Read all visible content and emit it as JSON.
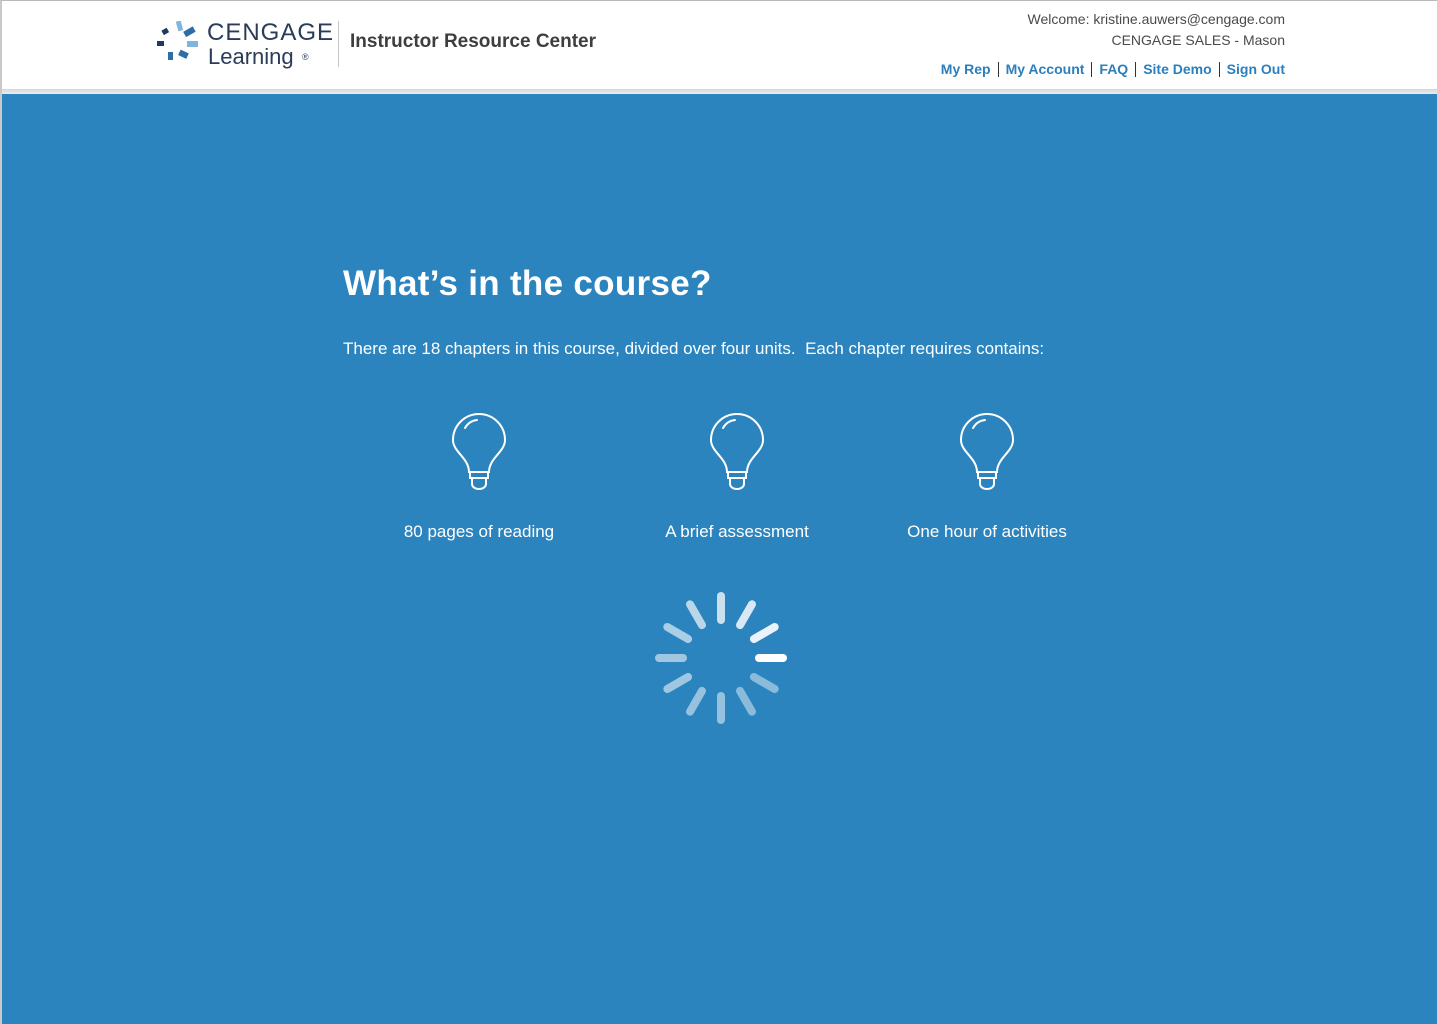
{
  "header": {
    "logo_top": "CENGAGE",
    "logo_bottom": "Learning",
    "logo_reg": "®",
    "site_title": "Instructor Resource Center",
    "welcome": "Welcome: kristine.auwers@cengage.com",
    "account_name": "CENGAGE SALES - Mason",
    "nav": {
      "my_rep": "My Rep",
      "my_account": "My Account",
      "faq": "FAQ",
      "site_demo": "Site Demo",
      "sign_out": "Sign Out"
    }
  },
  "main": {
    "heading": "What’s in the course?",
    "intro": "There are 18 chapters in this course, divided over four units.  Each chapter requires contains:",
    "features": [
      {
        "icon": "lightbulb-icon",
        "label": "80 pages of reading"
      },
      {
        "icon": "lightbulb-icon",
        "label": "A brief assessment"
      },
      {
        "icon": "lightbulb-icon",
        "label": "One hour of activities"
      }
    ],
    "loading_icon": "spinner-icon"
  },
  "colors": {
    "background": "#2b84be",
    "nav_link": "#2a7fbf",
    "logo_text": "#2a3c57"
  }
}
